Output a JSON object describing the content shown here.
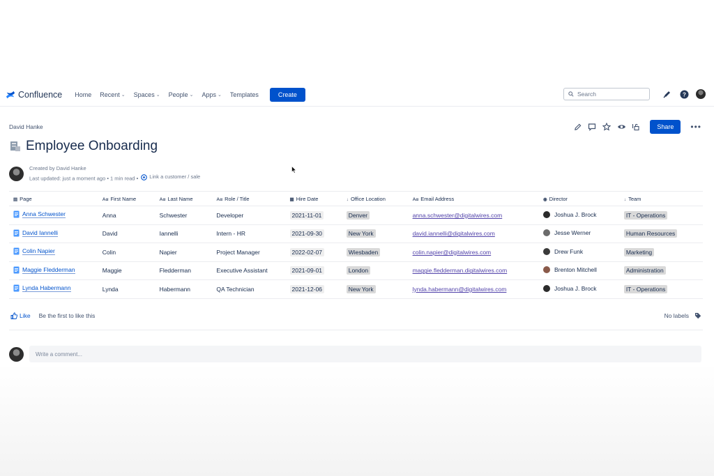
{
  "nav": {
    "app_name": "Confluence",
    "items": [
      {
        "label": "Home",
        "dropdown": false
      },
      {
        "label": "Recent",
        "dropdown": true
      },
      {
        "label": "Spaces",
        "dropdown": true
      },
      {
        "label": "People",
        "dropdown": true
      },
      {
        "label": "Apps",
        "dropdown": true
      },
      {
        "label": "Templates",
        "dropdown": false
      }
    ],
    "create_label": "Create",
    "search_placeholder": "Search"
  },
  "breadcrumb": "David Hanke",
  "page": {
    "title": "Employee Onboarding",
    "created_by": "Created by David Hanke",
    "last_updated": "Last updated: just a moment ago",
    "read_time": "1 min read",
    "link_customer": "Link a customer / sale"
  },
  "share_label": "Share",
  "table": {
    "headers": [
      "Page",
      "First Name",
      "Last Name",
      "Role / Title",
      "Hire Date",
      "Office Location",
      "Email Address",
      "Director",
      "Team"
    ],
    "header_icons": [
      "page-icon",
      "text-icon",
      "text-icon",
      "text-icon",
      "calendar-icon",
      "arrow-down-icon",
      "text-icon",
      "person-icon",
      "arrow-down-icon"
    ],
    "rows": [
      {
        "page": "Anna Schwester",
        "first": "Anna",
        "last": "Schwester",
        "role": "Developer",
        "hire": "2021-11-01",
        "office": "Denver",
        "email": "anna.schwester@digitalwires.com",
        "director": "Joshua J. Brock",
        "team": "IT - Operations"
      },
      {
        "page": "David Iannelli",
        "first": "David",
        "last": "Iannelli",
        "role": "Intern - HR",
        "hire": "2021-09-30",
        "office": "New York",
        "email": "david.iannelli@digitalwires.com",
        "director": "Jesse Werner",
        "team": "Human Resources"
      },
      {
        "page": "Colin Napier",
        "first": "Colin",
        "last": "Napier",
        "role": "Project Manager",
        "hire": "2022-02-07",
        "office": "Wiesbaden",
        "email": "colin.napier@digitalwires.com",
        "director": "Drew Funk",
        "team": "Marketing"
      },
      {
        "page": "Maggie Fledderman",
        "first": "Maggie",
        "last": "Fledderman",
        "role": "Executive Assistant",
        "hire": "2021-09-01",
        "office": "London",
        "email": "maggie.fledderman.digitalwires.com",
        "director": "Brenton Mitchell",
        "team": "Administration"
      },
      {
        "page": "Lynda Habermann",
        "first": "Lynda",
        "last": "Habermann",
        "role": "QA Technician",
        "hire": "2021-12-06",
        "office": "New York",
        "email": "lynda.habermann@digitalwires.com",
        "director": "Joshua J. Brock",
        "team": "IT - Operations"
      }
    ]
  },
  "footer": {
    "like_label": "Like",
    "like_prompt": "Be the first to like this",
    "labels_text": "No labels",
    "comment_placeholder": "Write a comment..."
  },
  "colors": {
    "primary": "#0052cc",
    "text": "#172b4d",
    "lozenge": "#d9d9d9",
    "email": "#5243aa"
  }
}
